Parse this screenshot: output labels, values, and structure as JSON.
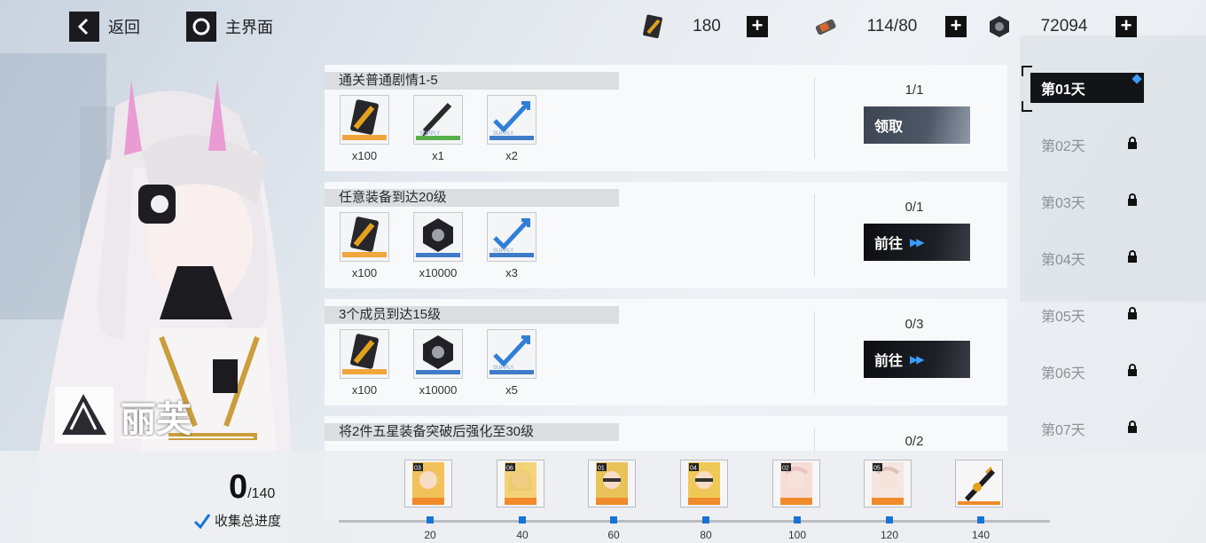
{
  "top": {
    "back_label": "返回",
    "home_label": "主界面",
    "resources": [
      {
        "icon": "gold-ticket-icon",
        "value": "180"
      },
      {
        "icon": "battery-icon",
        "value": "114/80"
      },
      {
        "icon": "hex-nut-icon",
        "value": "72094"
      }
    ],
    "plus_symbol": "+"
  },
  "character": {
    "name": "丽芙"
  },
  "tasks": [
    {
      "title": "通关普通剧情1-5",
      "progress": "1/1",
      "button": "领取",
      "button_type": "claim",
      "rewards": [
        {
          "icon": "gold-ticket-icon",
          "qty": "x100"
        },
        {
          "icon": "pen-supply-icon",
          "qty": "x1"
        },
        {
          "icon": "exp-arrow-supply-icon",
          "qty": "x2"
        }
      ]
    },
    {
      "title": "任意装备到达20级",
      "progress": "0/1",
      "button": "前往",
      "button_type": "go",
      "rewards": [
        {
          "icon": "gold-ticket-icon",
          "qty": "x100"
        },
        {
          "icon": "hex-nut-icon",
          "qty": "x10000"
        },
        {
          "icon": "exp-arrow-supply-icon",
          "qty": "x3"
        }
      ]
    },
    {
      "title": "3个成员到达15级",
      "progress": "0/3",
      "button": "前往",
      "button_type": "go",
      "rewards": [
        {
          "icon": "gold-ticket-icon",
          "qty": "x100"
        },
        {
          "icon": "hex-nut-icon",
          "qty": "x10000"
        },
        {
          "icon": "exp-arrow-supply-icon",
          "qty": "x5"
        }
      ]
    },
    {
      "title": "将2件五星装备突破后强化至30级",
      "progress": "0/2"
    }
  ],
  "supply_label": "SUPPLY",
  "days": [
    {
      "label": "第01天",
      "active": true,
      "locked": false
    },
    {
      "label": "第02天",
      "active": false,
      "locked": true
    },
    {
      "label": "第03天",
      "active": false,
      "locked": true
    },
    {
      "label": "第04天",
      "active": false,
      "locked": true
    },
    {
      "label": "第05天",
      "active": false,
      "locked": true
    },
    {
      "label": "第06天",
      "active": false,
      "locked": true
    },
    {
      "label": "第07天",
      "active": false,
      "locked": true
    }
  ],
  "collection": {
    "current": "0",
    "total": "/140",
    "label": "收集总进度"
  },
  "milestones": [
    {
      "value": "20",
      "card_no": "03"
    },
    {
      "value": "40",
      "card_no": "06"
    },
    {
      "value": "60",
      "card_no": "01"
    },
    {
      "value": "80",
      "card_no": "04"
    },
    {
      "value": "100",
      "card_no": "02"
    },
    {
      "value": "120",
      "card_no": "05"
    },
    {
      "value": "140",
      "card_no": ""
    }
  ],
  "colors": {
    "accent_blue": "#1773d6",
    "dark": "#131418",
    "gold": "#e2a21c"
  }
}
